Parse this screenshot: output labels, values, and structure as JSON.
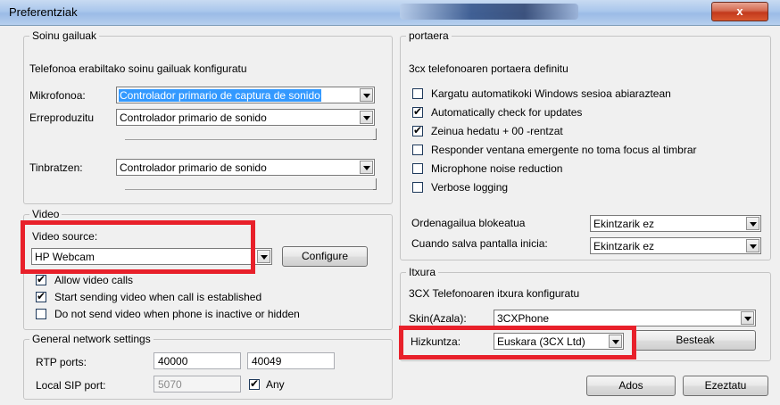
{
  "window": {
    "title": "Preferentziak",
    "close_label": "x"
  },
  "sound": {
    "legend": "Soinu gailuak",
    "description": "Telefonoa erabiltako soinu gailuak konfiguratu",
    "microphone_label": "Mikrofonoa:",
    "microphone_value": "Controlador primario de captura de sonido",
    "playback_label": "Erreproduzitu",
    "playback_value": "Controlador primario de sonido",
    "ringer_label": "Tinbratzen:",
    "ringer_value": "Controlador primario de sonido"
  },
  "video": {
    "legend": "Video",
    "source_label": "Video source:",
    "source_value": "HP Webcam",
    "configure_label": "Configure",
    "options": [
      {
        "label": "Allow video calls",
        "checked": true
      },
      {
        "label": "Start sending video when call is established",
        "checked": true
      },
      {
        "label": "Do not send video when phone is inactive or hidden",
        "checked": false
      }
    ]
  },
  "network": {
    "legend": "General network settings",
    "rtp_label": "RTP ports:",
    "rtp_from": "40000",
    "rtp_to": "40049",
    "sip_label": "Local SIP port:",
    "sip_value": "5070",
    "any_label": "Any",
    "any_checked": true
  },
  "behavior": {
    "legend": "portaera",
    "description": "3cx telefonoaren portaera definitu",
    "options": [
      {
        "label": "Kargatu automatikoki Windows sesioa abiaraztean",
        "checked": false
      },
      {
        "label": "Automatically check for updates",
        "checked": true
      },
      {
        "label": "Zeinua hedatu + 00 -rentzat",
        "checked": true
      },
      {
        "label": "Responder ventana emergente no toma focus al timbrar",
        "checked": false
      },
      {
        "label": "Microphone noise reduction",
        "checked": false
      },
      {
        "label": "Verbose logging",
        "checked": false
      }
    ],
    "lock_label": "Ordenagailua blokeatua",
    "lock_value": "Ekintzarik ez",
    "screensaver_label": "Cuando salva pantalla inicia:",
    "screensaver_value": "Ekintzarik ez"
  },
  "appearance": {
    "legend": "Itxura",
    "description": "3CX Telefonoaren itxura konfiguratu",
    "skin_label": "Skin(Azala):",
    "skin_value": "3CXPhone",
    "language_label": "Hizkuntza:",
    "language_value": "Euskara (3CX Ltd)",
    "others_label": "Besteak"
  },
  "footer": {
    "ok_label": "Ados",
    "cancel_label": "Ezeztatu"
  },
  "colors": {
    "highlight": "#e8202a",
    "selection": "#3399ff"
  }
}
